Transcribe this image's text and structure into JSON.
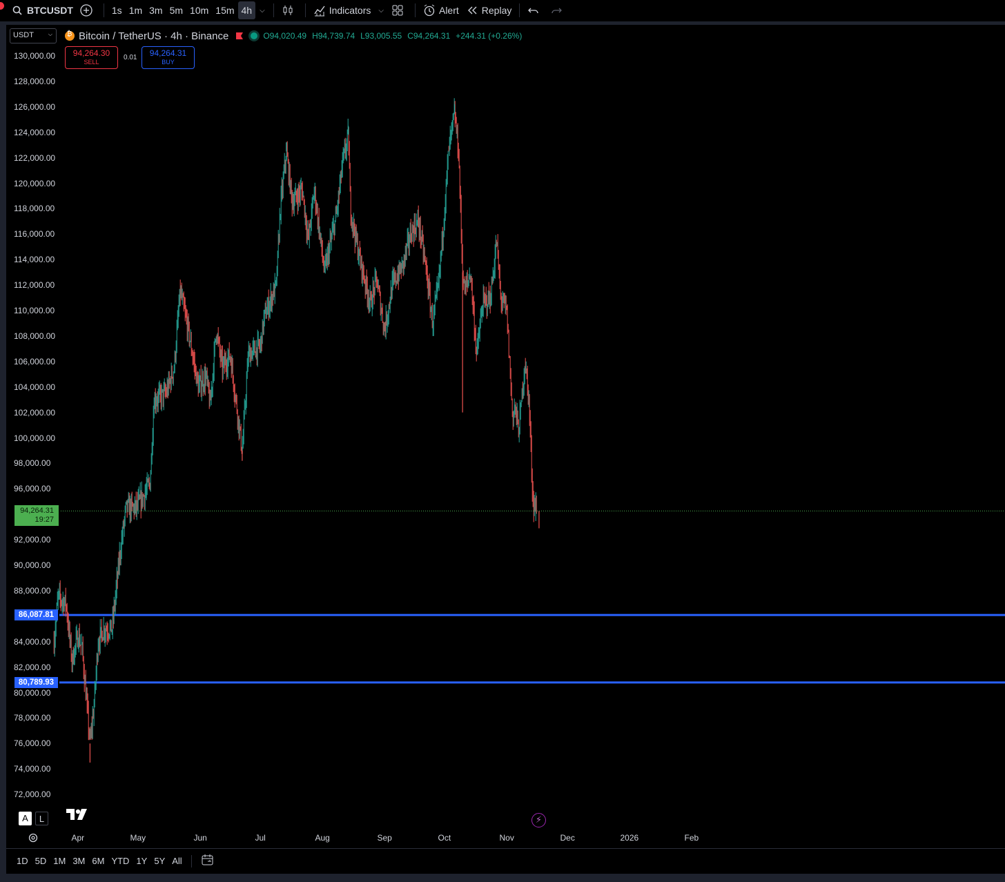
{
  "toolbar": {
    "symbol": "BTCUSDT",
    "intervals": [
      "1s",
      "1m",
      "3m",
      "5m",
      "10m",
      "15m",
      "4h"
    ],
    "active_interval": "4h",
    "indicators_label": "Indicators",
    "alert_label": "Alert",
    "replay_label": "Replay"
  },
  "legend": {
    "currency": "USDT",
    "title": "Bitcoin / TetherUS · 4h · Binance",
    "open": "O94,020.49",
    "high": "H94,739.74",
    "low": "L93,005.55",
    "close": "C94,264.31",
    "change": "+244.31 (+0.26%)"
  },
  "trade": {
    "sell_price": "94,264.30",
    "sell_label": "SELL",
    "quantity": "0.01",
    "buy_price": "94,264.31",
    "buy_label": "BUY"
  },
  "price_flag": {
    "price": "94,264.31",
    "countdown": "19:27"
  },
  "hlines": [
    {
      "label": "86,087.81",
      "value": 86087.81,
      "color": "#2962ff"
    },
    {
      "label": "80,789.93",
      "value": 80789.93,
      "color": "#2962ff"
    }
  ],
  "scale": {
    "auto": "A",
    "log": "L"
  },
  "bottom": {
    "ranges": [
      "1D",
      "5D",
      "1M",
      "3M",
      "6M",
      "YTD",
      "1Y",
      "5Y",
      "All"
    ]
  },
  "chart_data": {
    "type": "candlestick",
    "title": "Bitcoin / TetherUS · 4h · Binance",
    "y_ticks": [
      130000,
      128000,
      126000,
      124000,
      122000,
      120000,
      118000,
      116000,
      114000,
      112000,
      110000,
      108000,
      106000,
      104000,
      102000,
      100000,
      98000,
      96000,
      92000,
      90000,
      88000,
      84000,
      82000,
      80000,
      78000,
      76000,
      74000,
      72000
    ],
    "y_tick_labels": [
      "130,000.00",
      "128,000.00",
      "126,000.00",
      "124,000.00",
      "122,000.00",
      "120,000.00",
      "118,000.00",
      "116,000.00",
      "114,000.00",
      "112,000.00",
      "110,000.00",
      "108,000.00",
      "106,000.00",
      "104,000.00",
      "102,000.00",
      "100,000.00",
      "98,000.00",
      "96,000.00",
      "92,000.00",
      "90,000.00",
      "88,000.00",
      "84,000.00",
      "82,000.00",
      "80,000.00",
      "78,000.00",
      "76,000.00",
      "74,000.00",
      "72,000.00"
    ],
    "x_labels": [
      "Apr",
      "May",
      "Jun",
      "Jul",
      "Aug",
      "Sep",
      "Oct",
      "Nov",
      "Dec",
      "2026",
      "Feb"
    ],
    "ylim": [
      71000,
      131000
    ],
    "last_price": 94264.31,
    "up_color": "#26a69a",
    "down_color": "#ef5350",
    "price_path": [
      {
        "date": "2025-03-20",
        "price": 84000
      },
      {
        "date": "2025-03-22",
        "price": 87500
      },
      {
        "date": "2025-03-26",
        "price": 87000
      },
      {
        "date": "2025-03-29",
        "price": 82500
      },
      {
        "date": "2025-04-01",
        "price": 84500
      },
      {
        "date": "2025-04-03",
        "price": 83500
      },
      {
        "date": "2025-04-07",
        "price": 76000
      },
      {
        "date": "2025-04-09",
        "price": 79000
      },
      {
        "date": "2025-04-11",
        "price": 84000
      },
      {
        "date": "2025-04-14",
        "price": 85000
      },
      {
        "date": "2025-04-18",
        "price": 85000
      },
      {
        "date": "2025-04-22",
        "price": 91000
      },
      {
        "date": "2025-04-25",
        "price": 94500
      },
      {
        "date": "2025-04-30",
        "price": 94500
      },
      {
        "date": "2025-05-04",
        "price": 95500
      },
      {
        "date": "2025-05-07",
        "price": 96500
      },
      {
        "date": "2025-05-09",
        "price": 103000
      },
      {
        "date": "2025-05-15",
        "price": 103500
      },
      {
        "date": "2025-05-19",
        "price": 105500
      },
      {
        "date": "2025-05-22",
        "price": 111500
      },
      {
        "date": "2025-05-26",
        "price": 108500
      },
      {
        "date": "2025-05-31",
        "price": 104000
      },
      {
        "date": "2025-06-04",
        "price": 104800
      },
      {
        "date": "2025-06-06",
        "price": 102500
      },
      {
        "date": "2025-06-09",
        "price": 108500
      },
      {
        "date": "2025-06-12",
        "price": 105500
      },
      {
        "date": "2025-06-16",
        "price": 106500
      },
      {
        "date": "2025-06-22",
        "price": 99000
      },
      {
        "date": "2025-06-25",
        "price": 106500
      },
      {
        "date": "2025-07-01",
        "price": 107200
      },
      {
        "date": "2025-07-03",
        "price": 109500
      },
      {
        "date": "2025-07-09",
        "price": 112000
      },
      {
        "date": "2025-07-11",
        "price": 118000
      },
      {
        "date": "2025-07-14",
        "price": 122500
      },
      {
        "date": "2025-07-17",
        "price": 118500
      },
      {
        "date": "2025-07-22",
        "price": 119500
      },
      {
        "date": "2025-07-25",
        "price": 115500
      },
      {
        "date": "2025-07-28",
        "price": 119500
      },
      {
        "date": "2025-08-02",
        "price": 113000
      },
      {
        "date": "2025-08-08",
        "price": 117500
      },
      {
        "date": "2025-08-11",
        "price": 121500
      },
      {
        "date": "2025-08-14",
        "price": 123800
      },
      {
        "date": "2025-08-15",
        "price": 118000
      },
      {
        "date": "2025-08-19",
        "price": 114500
      },
      {
        "date": "2025-08-25",
        "price": 110500
      },
      {
        "date": "2025-08-28",
        "price": 112500
      },
      {
        "date": "2025-09-01",
        "price": 108500
      },
      {
        "date": "2025-09-05",
        "price": 112000
      },
      {
        "date": "2025-09-10",
        "price": 113500
      },
      {
        "date": "2025-09-14",
        "price": 116000
      },
      {
        "date": "2025-09-18",
        "price": 117000
      },
      {
        "date": "2025-09-22",
        "price": 113000
      },
      {
        "date": "2025-09-25",
        "price": 109000
      },
      {
        "date": "2025-09-28",
        "price": 112000
      },
      {
        "date": "2025-10-01",
        "price": 118000
      },
      {
        "date": "2025-10-03",
        "price": 122500
      },
      {
        "date": "2025-10-06",
        "price": 125500
      },
      {
        "date": "2025-10-08",
        "price": 122500
      },
      {
        "date": "2025-10-10",
        "price": 113000
      },
      {
        "date": "2025-10-11",
        "price": 111500
      },
      {
        "date": "2025-10-14",
        "price": 113000
      },
      {
        "date": "2025-10-17",
        "price": 106500
      },
      {
        "date": "2025-10-20",
        "price": 110500
      },
      {
        "date": "2025-10-24",
        "price": 111000
      },
      {
        "date": "2025-10-27",
        "price": 115500
      },
      {
        "date": "2025-10-29",
        "price": 111000
      },
      {
        "date": "2025-11-01",
        "price": 110000
      },
      {
        "date": "2025-11-04",
        "price": 101500
      },
      {
        "date": "2025-11-05",
        "price": 102500
      },
      {
        "date": "2025-11-07",
        "price": 100500
      },
      {
        "date": "2025-11-10",
        "price": 106000
      },
      {
        "date": "2025-11-12",
        "price": 103000
      },
      {
        "date": "2025-11-14",
        "price": 95000
      },
      {
        "date": "2025-11-16",
        "price": 94264
      }
    ],
    "wicks": [
      {
        "date": "2025-04-07",
        "low": 74500
      },
      {
        "date": "2025-06-22",
        "low": 98200
      },
      {
        "date": "2025-07-14",
        "high": 123200
      },
      {
        "date": "2025-08-14",
        "high": 124500
      },
      {
        "date": "2025-10-06",
        "high": 126200
      },
      {
        "date": "2025-10-10",
        "low": 102000
      },
      {
        "date": "2025-11-17",
        "low": 92900
      }
    ]
  }
}
